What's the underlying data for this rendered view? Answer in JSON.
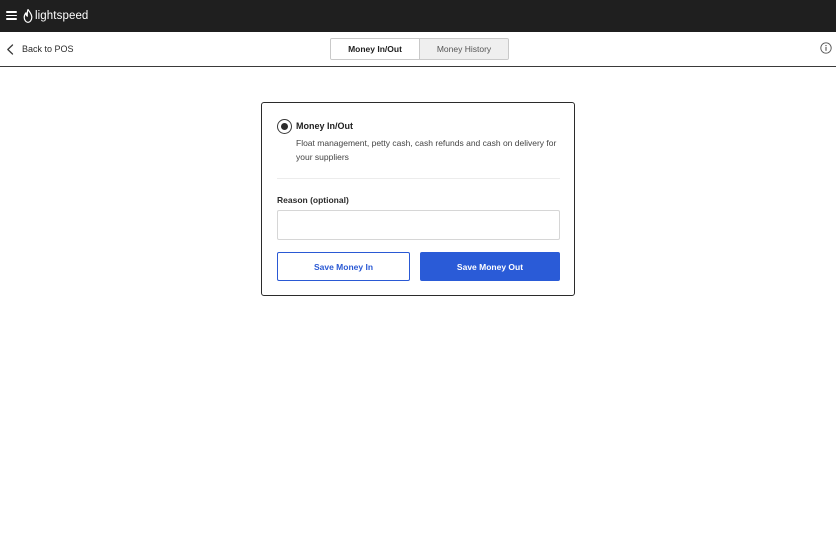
{
  "brand": {
    "name": "lightspeed",
    "bar_color": "#1f1f1f"
  },
  "icons": {
    "menu": "hamburger-menu-icon",
    "logo": "flame-logo-icon",
    "back": "chevron-left-icon",
    "info": "info-circle-icon"
  },
  "header": {
    "back_label": "Back to POS",
    "tabs": [
      {
        "label": "Money In/Out",
        "active": true
      },
      {
        "label": "Money History",
        "active": false
      }
    ]
  },
  "card": {
    "option_title": "Money In/Out",
    "option_description": "Float management, petty cash, cash refunds and cash on delivery for your suppliers",
    "option_selected": true,
    "reason_label": "Reason (optional)",
    "reason_value": "",
    "reason_placeholder": "",
    "save_in_label": "Save Money In",
    "save_out_label": "Save Money Out"
  },
  "colors": {
    "accent": "#2a5bd7",
    "text": "#2b2b2b"
  }
}
